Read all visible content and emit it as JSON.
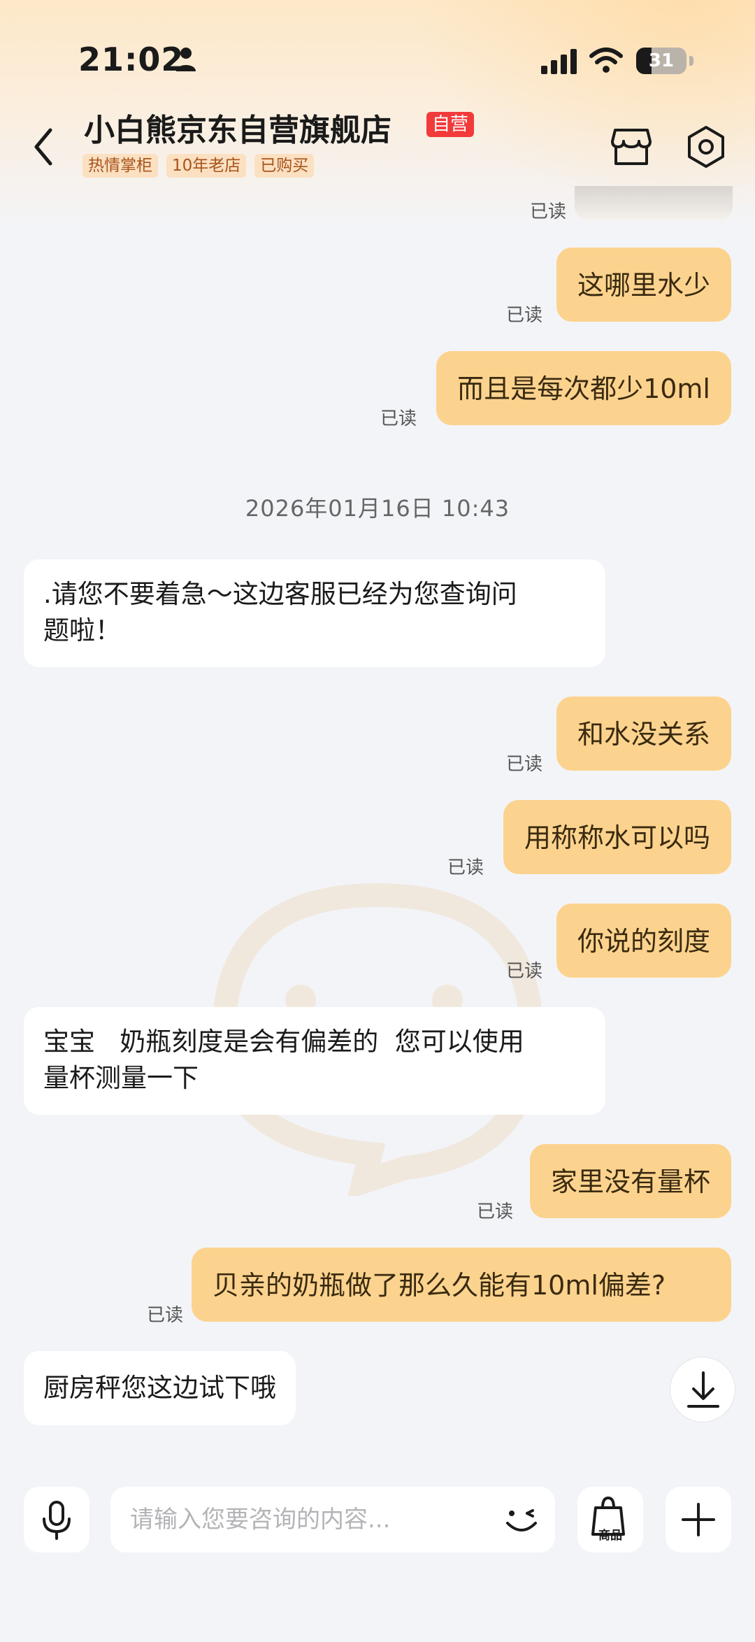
{
  "status_bar": {
    "time": "21:02",
    "battery": "31",
    "battery_fraction": 0.31
  },
  "header": {
    "title": "小白熊京东自营旗舰店",
    "badge": "自营",
    "tags": [
      "热情掌柜",
      "10年老店",
      "已购买"
    ]
  },
  "chat": {
    "read_label": "已读",
    "timestamp": "2026年01月16日 10:43",
    "messages": [
      {
        "from": "me",
        "text": "这哪里水少"
      },
      {
        "from": "me",
        "text": "而且是每次都少10ml"
      },
      {
        "from": "them",
        "lines": [
          ".请您不要着急～这边客服已经为您查询问",
          "题啦！"
        ]
      },
      {
        "from": "me",
        "text": "和水没关系"
      },
      {
        "from": "me",
        "text": "用称称水可以吗"
      },
      {
        "from": "me",
        "text": "你说的刻度"
      },
      {
        "from": "them",
        "lines": [
          "宝宝   奶瓶刻度是会有偏差的  您可以使用",
          "量杯测量一下"
        ]
      },
      {
        "from": "me",
        "text": "家里没有量杯"
      },
      {
        "from": "me",
        "text": "贝亲的奶瓶做了那么久能有10ml偏差?"
      },
      {
        "from": "them",
        "lines": [
          "厨房秤您这边试下哦"
        ]
      }
    ]
  },
  "input_bar": {
    "placeholder": "请输入您要咨询的内容...",
    "goods_label": "商品"
  },
  "colors": {
    "my_bubble": "#fcd38e",
    "their_bubble": "#ffffff",
    "badge_red": "#f23a3a",
    "tag_bg": "#fbe0c2"
  }
}
